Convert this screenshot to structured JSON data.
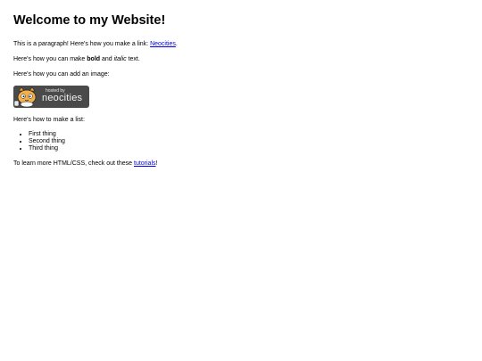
{
  "heading": "Welcome to my Website!",
  "para1": {
    "before": "This is a paragraph! Here's how you make a link: ",
    "link": "Neocities",
    "after": "."
  },
  "para2": {
    "before": "Here's how you can make ",
    "bold": "bold",
    "middle": " and ",
    "italic": "italic",
    "after": " text."
  },
  "para3": "Here's how you can add an image:",
  "badge": {
    "small_text": "hosted by",
    "large_text": "neocities",
    "icon": "neocities-cat-icon"
  },
  "para4": "Here's how to make a list:",
  "list": [
    "First thing",
    "Second thing",
    "Third thing"
  ],
  "para5": {
    "before": "To learn more HTML/CSS, check out these ",
    "link": "tutorials",
    "after": "!"
  },
  "colors": {
    "link": "#0000ee",
    "badge_bg": "#4a4a4a"
  }
}
